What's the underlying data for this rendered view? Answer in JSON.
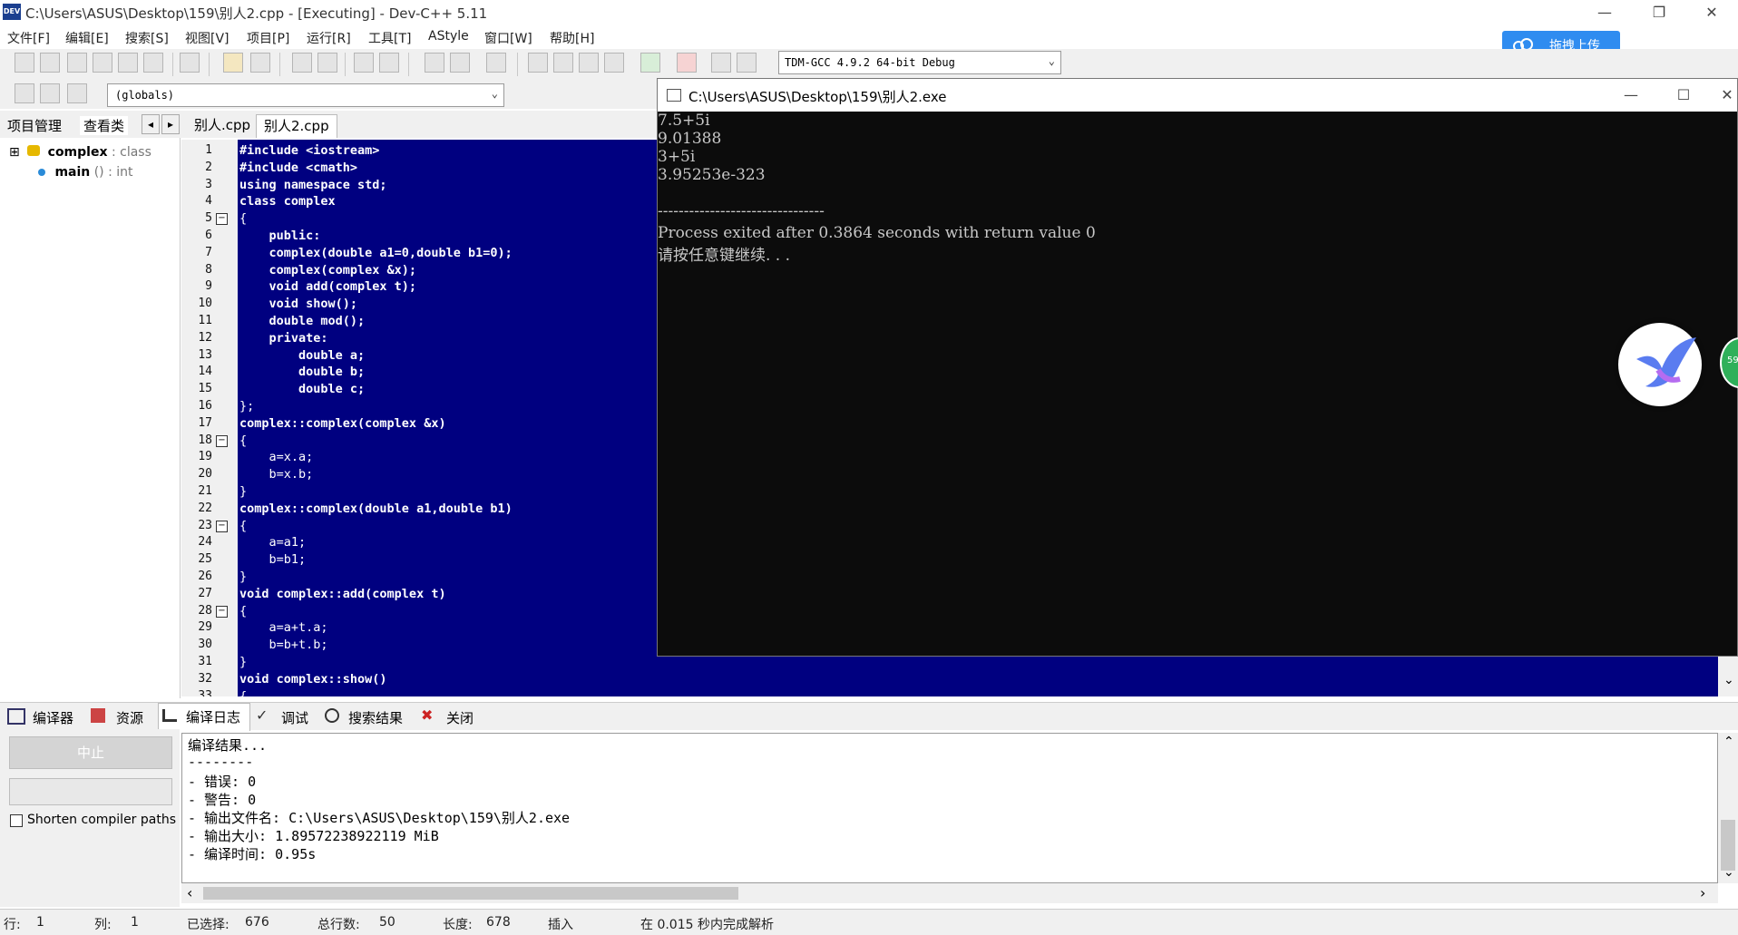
{
  "window": {
    "title": "C:\\Users\\ASUS\\Desktop\\159\\别人2.cpp - [Executing] - Dev-C++ 5.11",
    "app_icon_text": "DEV",
    "controls": {
      "minimize": "—",
      "restore": "❐",
      "close": "✕"
    }
  },
  "menu": [
    "文件[F]",
    "编辑[E]",
    "搜索[S]",
    "视图[V]",
    "项目[P]",
    "运行[R]",
    "工具[T]",
    "AStyle",
    "窗口[W]",
    "帮助[H]"
  ],
  "upload_button": {
    "label": "拖拽上传"
  },
  "toolbar": {
    "compiler_select": "TDM-GCC 4.9.2 64-bit Debug",
    "scope_select": "(globals)"
  },
  "left_panel": {
    "tabs": [
      "项目管理",
      "查看类"
    ],
    "nav": [
      "◂",
      "▸"
    ],
    "tree": [
      {
        "name": "complex",
        "kind": ": class",
        "expander": "⊞"
      },
      {
        "name": "main",
        "kind": "() : int"
      }
    ]
  },
  "editor": {
    "tabs": [
      "别人.cpp",
      "别人2.cpp"
    ],
    "active_tab": 1,
    "line_numbers": [
      "1",
      "2",
      "3",
      "4",
      "5",
      "6",
      "7",
      "8",
      "9",
      "10",
      "11",
      "12",
      "13",
      "14",
      "15",
      "16",
      "17",
      "18",
      "19",
      "20",
      "21",
      "22",
      "23",
      "24",
      "25",
      "26",
      "27",
      "28",
      "29",
      "30",
      "31",
      "32",
      "33"
    ],
    "lines": [
      "#include <iostream>",
      "#include <cmath>",
      "using namespace std;",
      "class complex",
      "{",
      "    public:",
      "    complex(double a1=0,double b1=0);",
      "    complex(complex &x);",
      "    void add(complex t);",
      "    void show();",
      "    double mod();",
      "    private:",
      "        double a;",
      "        double b;",
      "        double c;",
      "};",
      "complex::complex(complex &x)",
      "{",
      "    a=x.a;",
      "    b=x.b;",
      "}",
      "complex::complex(double a1,double b1)",
      "{",
      "    a=a1;",
      "    b=b1;",
      "}",
      "void complex::add(complex t)",
      "{",
      "    a=a+t.a;",
      "    b=b+t.b;",
      "}",
      "void complex::show()",
      "{"
    ],
    "scroll_down": "⌄"
  },
  "console": {
    "title": "C:\\Users\\ASUS\\Desktop\\159\\别人2.exe",
    "controls": {
      "minimize": "—",
      "maximize": "☐",
      "close": "✕"
    },
    "lines": [
      "7.5+5i",
      "9.01388",
      "3+5i",
      "3.95253e-323",
      "",
      "--------------------------------",
      "Process exited after 0.3864 seconds with return value 0",
      "请按任意键继续. . ."
    ]
  },
  "floating": {
    "green_badge": "59"
  },
  "bottom_tabs": [
    {
      "label": "编译器",
      "icon": "grid-icon"
    },
    {
      "label": "资源",
      "icon": "resources-icon"
    },
    {
      "label": "编译日志",
      "icon": "chart-icon"
    },
    {
      "label": "调试",
      "icon": "check-icon"
    },
    {
      "label": "搜索结果",
      "icon": "search-icon"
    },
    {
      "label": "关闭",
      "icon": "close-icon"
    }
  ],
  "bottom_left": {
    "stop_button": "中止",
    "shorten_label": "Shorten compiler paths"
  },
  "log": {
    "lines": [
      "编译结果...",
      "--------",
      "- 错误: 0",
      "- 警告: 0",
      "- 输出文件名: C:\\Users\\ASUS\\Desktop\\159\\别人2.exe",
      "- 输出大小: 1.89572238922119 MiB",
      "- 编译时间: 0.95s"
    ],
    "arrows": {
      "up": "⌃",
      "down": "⌄",
      "left": "‹",
      "right": "›"
    }
  },
  "status": {
    "row_label": "行:",
    "row": "1",
    "col_label": "列:",
    "col": "1",
    "sel_label": "已选择:",
    "sel": "676",
    "total_label": "总行数:",
    "total": "50",
    "len_label": "长度:",
    "len": "678",
    "mode": "插入",
    "parse": "在 0.015 秒内完成解析"
  }
}
